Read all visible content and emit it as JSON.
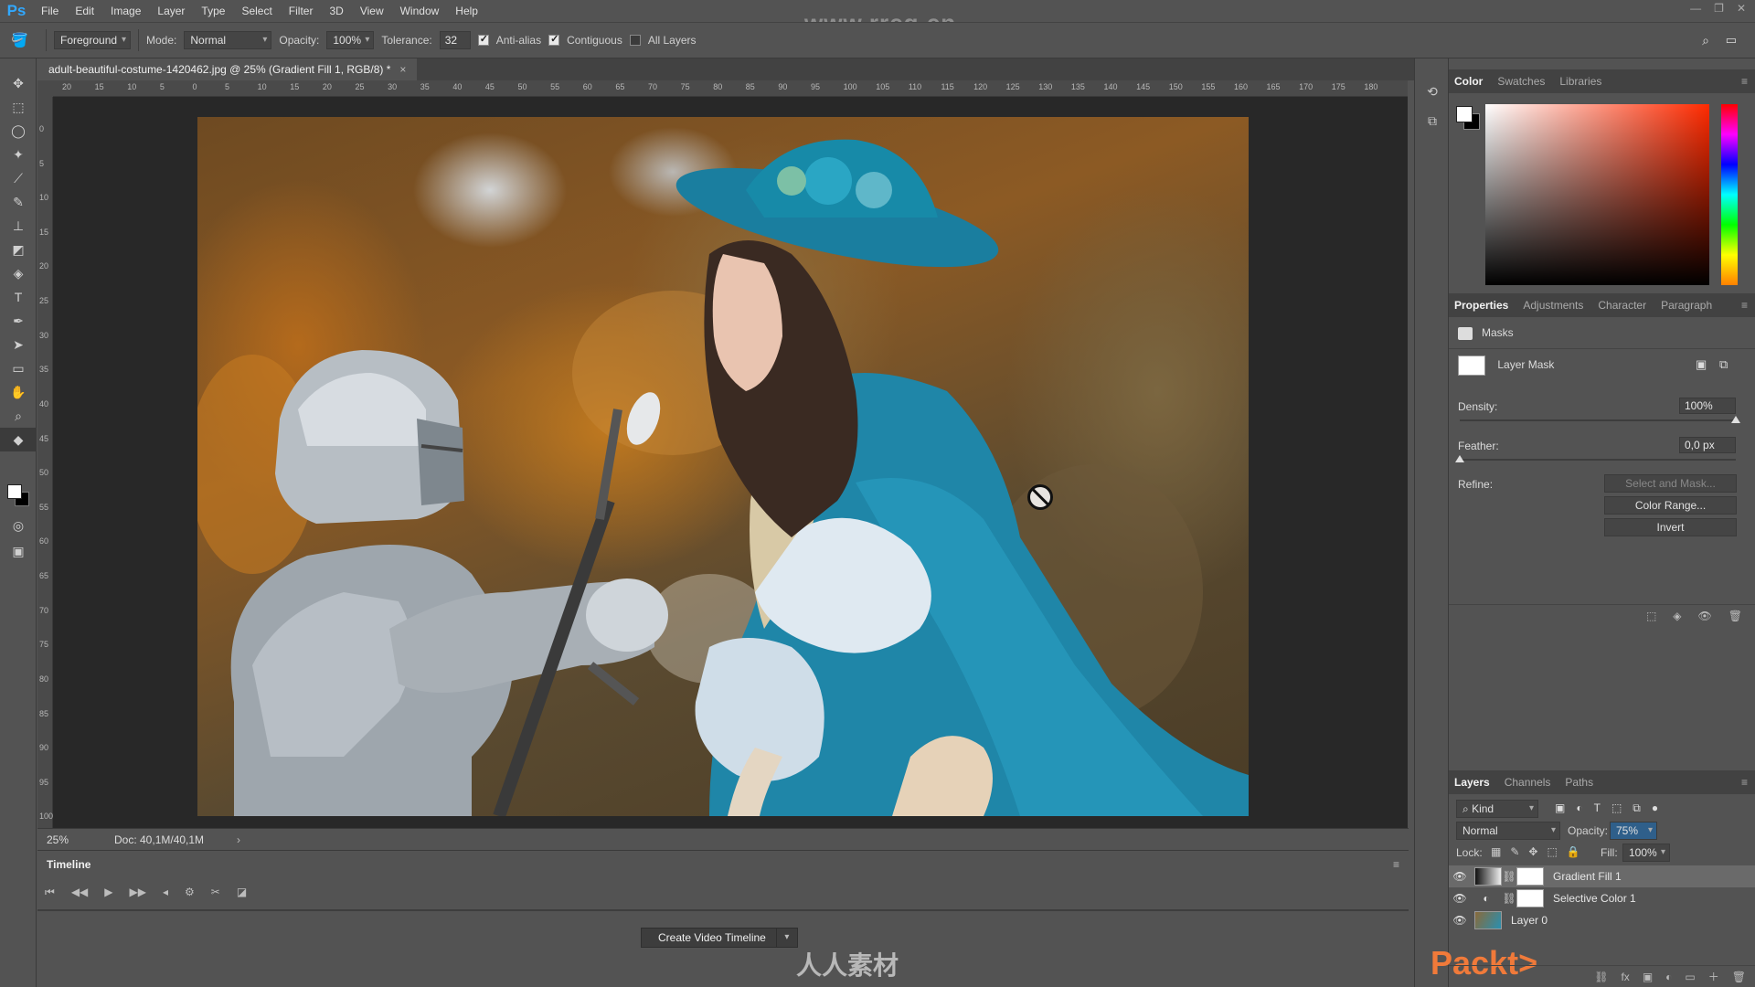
{
  "app": {
    "logo": "Ps"
  },
  "menu": [
    "File",
    "Edit",
    "Image",
    "Layer",
    "Type",
    "Select",
    "Filter",
    "3D",
    "View",
    "Window",
    "Help"
  ],
  "watermark": "www.rrcg.cn",
  "options": {
    "fill_source": "Foreground",
    "mode_label": "Mode:",
    "mode_value": "Normal",
    "opacity_label": "Opacity:",
    "opacity_value": "100%",
    "tolerance_label": "Tolerance:",
    "tolerance_value": "32",
    "antialias_label": "Anti-alias",
    "contiguous_label": "Contiguous",
    "all_layers_label": "All Layers"
  },
  "document": {
    "tab_title": "adult-beautiful-costume-1420462.jpg @ 25% (Gradient Fill 1, RGB/8) *",
    "close": "×",
    "ruler_h": [
      "20",
      "15",
      "10",
      "5",
      "0",
      "5",
      "10",
      "15",
      "20",
      "25",
      "30",
      "35",
      "40",
      "45",
      "50",
      "55",
      "60",
      "65",
      "70",
      "75",
      "80",
      "85",
      "90",
      "95",
      "100",
      "105",
      "110",
      "115",
      "120",
      "125",
      "130",
      "135",
      "140",
      "145",
      "150",
      "155",
      "160",
      "165",
      "170",
      "175",
      "180"
    ],
    "ruler_v": [
      "0",
      "5",
      "10",
      "15",
      "20",
      "25",
      "30",
      "35",
      "40",
      "45",
      "50",
      "55",
      "60",
      "65",
      "70",
      "75",
      "80",
      "85",
      "90",
      "95",
      "100"
    ]
  },
  "status": {
    "zoom": "25%",
    "doc_size": "Doc: 40,1M/40,1M"
  },
  "timeline": {
    "title": "Timeline",
    "create_button": "Create Video Timeline",
    "logo_text": "人人素材"
  },
  "color_panel": {
    "tabs": [
      "Color",
      "Swatches",
      "Libraries"
    ]
  },
  "properties_panel": {
    "tabs": [
      "Properties",
      "Adjustments",
      "Character",
      "Paragraph"
    ],
    "section": "Masks",
    "mask_type": "Layer Mask",
    "density_label": "Density:",
    "density_value": "100%",
    "density": 1.0,
    "feather_label": "Feather:",
    "feather_value": "0,0 px",
    "feather": 0.0,
    "refine_label": "Refine:",
    "select_mask_button": "Select and Mask...",
    "color_range_button": "Color Range...",
    "invert_button": "Invert"
  },
  "layers_panel": {
    "tabs": [
      "Layers",
      "Channels",
      "Paths"
    ],
    "filter_kind": "Kind",
    "blend_mode": "Normal",
    "opacity_label": "Opacity:",
    "opacity_value": "75%",
    "lock_label": "Lock:",
    "fill_label": "Fill:",
    "fill_value": "100%",
    "layers": [
      {
        "name": "Gradient Fill 1",
        "selected": true
      },
      {
        "name": "Selective Color 1",
        "selected": false
      },
      {
        "name": "Layer 0",
        "selected": false
      }
    ]
  },
  "brand": {
    "packt": "Packt>"
  }
}
